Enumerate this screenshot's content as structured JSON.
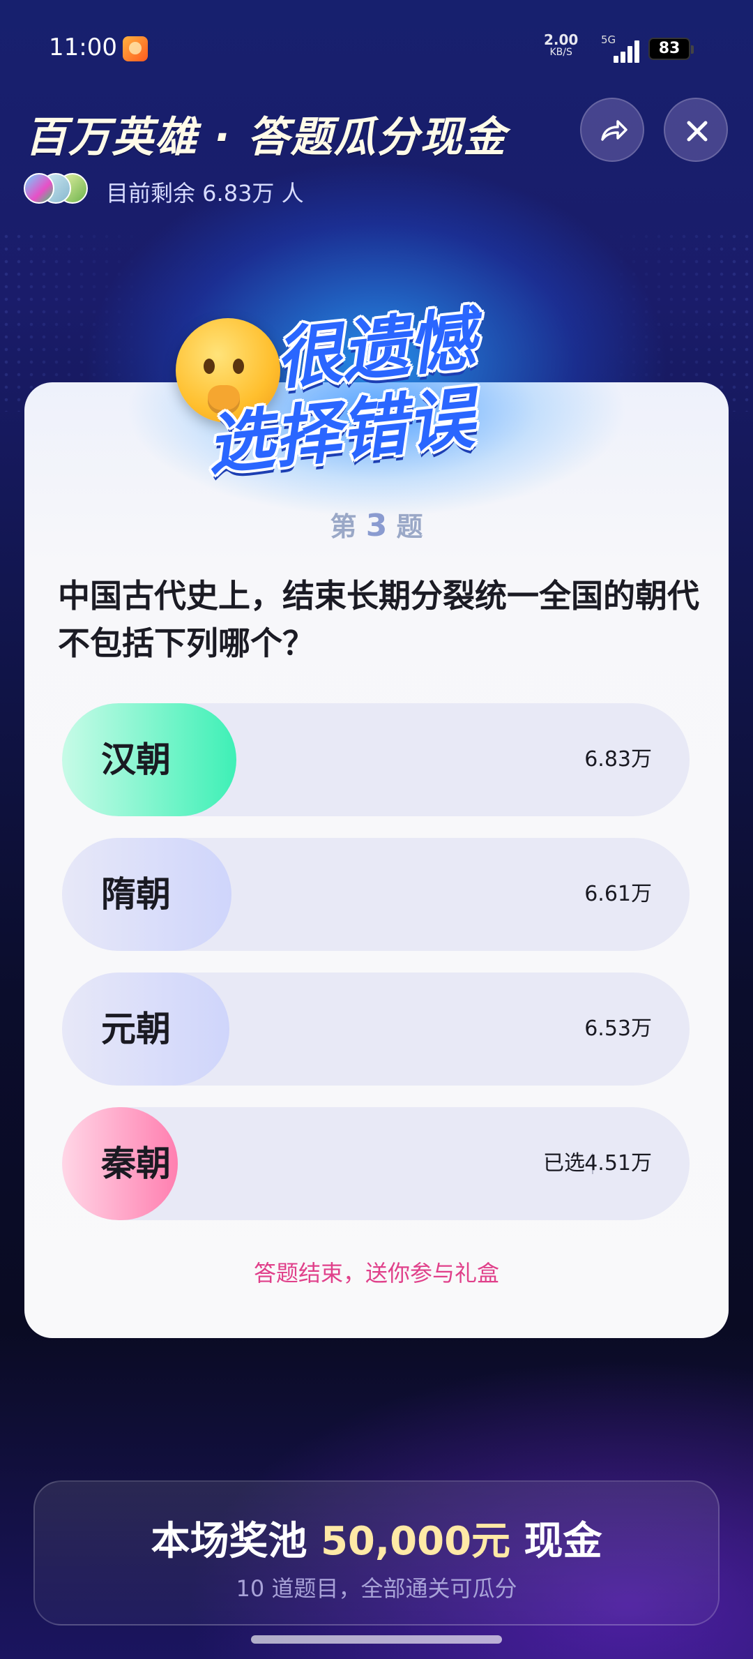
{
  "status_bar": {
    "time": "11:00",
    "net_speed": "2.00",
    "net_unit": "KB/S",
    "network_type": "5G",
    "battery": "83"
  },
  "header": {
    "title": "百万英雄 · 答题瓜分现金",
    "remaining_text": "目前剩余 6.83万 人",
    "share_icon": "share-icon",
    "close_icon": "close-icon"
  },
  "result": {
    "line1": "很遗憾",
    "line2": "选择错误",
    "emoji": "sad-face-emoji"
  },
  "question": {
    "number_prefix": "第",
    "number": "3",
    "number_suffix": "题",
    "text": "中国古代史上，结束长期分裂统一全国的朝代不包括下列哪个？"
  },
  "options": [
    {
      "label": "汉朝",
      "count": "6.83万",
      "state": "correct",
      "fill_ratio": 0.28
    },
    {
      "label": "隋朝",
      "count": "6.61万",
      "state": "neutral",
      "fill_ratio": 0.27
    },
    {
      "label": "元朝",
      "count": "6.53万",
      "state": "neutral",
      "fill_ratio": 0.27
    },
    {
      "label": "秦朝",
      "count": "4.51万",
      "state": "selected-wrong",
      "selected_label": "已选",
      "fill_ratio": 0.18
    }
  ],
  "footer_note": "答题结束，送你参与礼盒",
  "prize": {
    "prefix": "本场奖池",
    "amount": "50,000元",
    "suffix": "现金",
    "subtitle": "10 道题目，全部通关可瓜分"
  },
  "colors": {
    "correct": "#3ef0b6",
    "wrong": "#ff7fb0",
    "accent_text": "#e0408a",
    "banner_blue": "#2a66ff"
  }
}
